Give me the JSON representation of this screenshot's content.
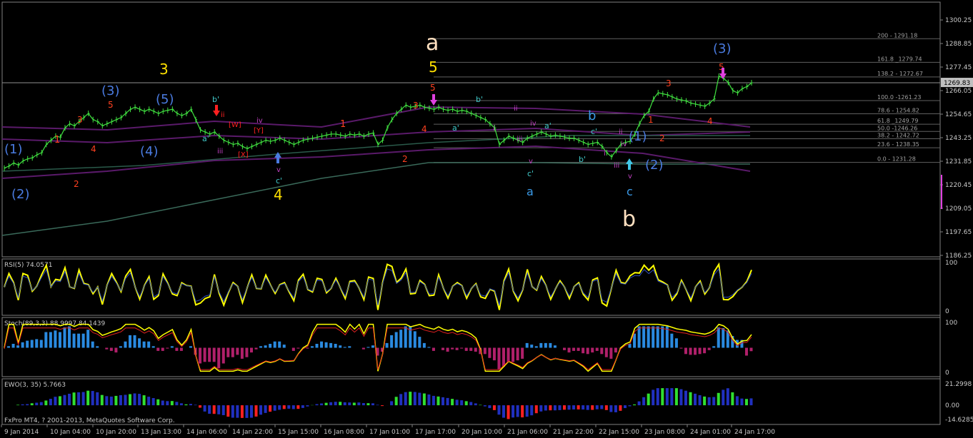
{
  "chart_data": {
    "type": "line",
    "platform_note": "FxPro MT4, ? 2001-2013, MetaQuotes Software Corp.",
    "main": {
      "ylim": [
        1186.25,
        1300.25
      ],
      "price_ticks": [
        "1300.25",
        "1288.85",
        "1277.45",
        "1266.05",
        "1254.65",
        "1243.25",
        "1231.85",
        "1220.45",
        "1209.05",
        "1197.65",
        "1186.25"
      ],
      "current_price": "1269.83",
      "fib_levels": [
        {
          "label": "200 - 1291.18"
        },
        {
          "label": "161.8 _1279.74"
        },
        {
          "label": "138.2 - 1272.67"
        },
        {
          "label": "100.0 -1261.23"
        },
        {
          "label": "78.6 - 1254.82"
        },
        {
          "label": "61.8 _1249.79"
        },
        {
          "label": "50.0 -1246.26"
        },
        {
          "label": "38.2 - 1242.72"
        },
        {
          "label": "23.6 - 1238.35"
        },
        {
          "label": "0.0 - 1231.28"
        }
      ],
      "wave_labels": [
        {
          "text": "(1)",
          "color": "#4a7be0"
        },
        {
          "text": "(2)",
          "color": "#4a7be0"
        },
        {
          "text": "1",
          "color": "#ff4020"
        },
        {
          "text": "2",
          "color": "#ff4020"
        },
        {
          "text": "3",
          "color": "#ff4020"
        },
        {
          "text": "4",
          "color": "#ff4020"
        },
        {
          "text": "5",
          "color": "#ff4020"
        },
        {
          "text": "(3)",
          "color": "#4a7be0"
        },
        {
          "text": "(4)",
          "color": "#4a7be0"
        },
        {
          "text": "(5)",
          "color": "#4a7be0"
        },
        {
          "text": "3",
          "color": "#ffe000"
        },
        {
          "text": "b'",
          "color": "#40c8c8"
        },
        {
          "text": "a'",
          "color": "#40c8c8"
        },
        {
          "text": "ii",
          "color": "#ff2020"
        },
        {
          "text": "[W]",
          "color": "#ff2020"
        },
        {
          "text": "iii",
          "color": "#c040c0"
        },
        {
          "text": "iv",
          "color": "#c040c0"
        },
        {
          "text": "[Y]",
          "color": "#ff2020"
        },
        {
          "text": "[X]",
          "color": "#ff2020"
        },
        {
          "text": "v",
          "color": "#c040c0"
        },
        {
          "text": "c'",
          "color": "#40c8c8"
        },
        {
          "text": "4",
          "color": "#ffe000"
        },
        {
          "text": "1",
          "color": "#ff4020"
        },
        {
          "text": "2",
          "color": "#ff4020"
        },
        {
          "text": "3",
          "color": "#ff4020"
        },
        {
          "text": "4",
          "color": "#ff4020"
        },
        {
          "text": "5",
          "color": "#ff4020"
        },
        {
          "text": "a",
          "color": "#ffe0c0"
        },
        {
          "text": "5",
          "color": "#ffe000"
        },
        {
          "text": "b'",
          "color": "#40c8c8"
        },
        {
          "text": "a'",
          "color": "#40c8c8"
        },
        {
          "text": "i",
          "color": "#c040c0"
        },
        {
          "text": "ii",
          "color": "#c040c0"
        },
        {
          "text": "iii",
          "color": "#c040c0"
        },
        {
          "text": "iv",
          "color": "#c040c0"
        },
        {
          "text": "a'",
          "color": "#40c8c8"
        },
        {
          "text": "v",
          "color": "#c040c0"
        },
        {
          "text": "c'",
          "color": "#40c8c8"
        },
        {
          "text": "a",
          "color": "#3a9ae8"
        },
        {
          "text": "b",
          "color": "#3a9ae8"
        },
        {
          "text": "c'",
          "color": "#40c8c8"
        },
        {
          "text": "b'",
          "color": "#40c8c8"
        },
        {
          "text": "i",
          "color": "#c040c0"
        },
        {
          "text": "ii",
          "color": "#c040c0"
        },
        {
          "text": "iii",
          "color": "#c040c0"
        },
        {
          "text": "iv",
          "color": "#c040c0"
        },
        {
          "text": "v",
          "color": "#c040c0"
        },
        {
          "text": "c",
          "color": "#3a9ae8"
        },
        {
          "text": "b",
          "color": "#ffe0c0"
        },
        {
          "text": "(1)",
          "color": "#4a7be0"
        },
        {
          "text": "(2)",
          "color": "#4a7be0"
        },
        {
          "text": "1",
          "color": "#ff4020"
        },
        {
          "text": "2",
          "color": "#ff4020"
        },
        {
          "text": "3",
          "color": "#ff4020"
        },
        {
          "text": "4",
          "color": "#ff4020"
        },
        {
          "text": "5",
          "color": "#ff4020"
        },
        {
          "text": "(3)",
          "color": "#4a7be0"
        }
      ],
      "series": [
        {
          "values": [
            1228.5,
            1229.5,
            1231,
            1230,
            1232,
            1233,
            1233.5,
            1235,
            1236,
            1240,
            1242,
            1244,
            1243.5,
            1248,
            1250,
            1249,
            1251,
            1253,
            1255,
            1252,
            1251,
            1249,
            1250,
            1251,
            1252,
            1253,
            1255,
            1257,
            1258,
            1257,
            1256,
            1257,
            1256,
            1255,
            1256,
            1256.5,
            1257,
            1255,
            1254,
            1255,
            1257,
            1252,
            1247,
            1246,
            1245,
            1246,
            1244,
            1242,
            1241,
            1240,
            1240.5,
            1239,
            1238,
            1239,
            1240,
            1241,
            1242,
            1241.5,
            1242,
            1243,
            1242,
            1241,
            1240,
            1241,
            1242,
            1242.5,
            1243,
            1243.5,
            1244,
            1244.5,
            1245,
            1245,
            1244.5,
            1244,
            1245,
            1244.5,
            1245,
            1244,
            1245,
            1245.5,
            1240,
            1242,
            1248,
            1252,
            1255,
            1257,
            1259,
            1258,
            1258.5,
            1259,
            1258,
            1257.5,
            1257,
            1258,
            1257,
            1256.5,
            1257,
            1256,
            1256.5,
            1256,
            1255,
            1254,
            1253,
            1252,
            1250,
            1248,
            1240,
            1242,
            1244,
            1243,
            1242,
            1241,
            1243,
            1244,
            1245,
            1246,
            1245,
            1244,
            1244.5,
            1244,
            1243.5,
            1243,
            1243,
            1242,
            1241,
            1240,
            1240.5,
            1241,
            1239,
            1236,
            1234,
            1237,
            1240,
            1241,
            1241.5,
            1245,
            1250,
            1254,
            1256,
            1262,
            1265,
            1264.5,
            1264,
            1263,
            1262,
            1261.5,
            1261,
            1260,
            1259.5,
            1259,
            1258.5,
            1260,
            1262,
            1273,
            1272,
            1270,
            1266,
            1265,
            1267,
            1268,
            1269.83
          ]
        }
      ]
    },
    "rsi": {
      "label": "RSI(5) 74.0571",
      "ticks": [
        "100",
        "0"
      ]
    },
    "stoch": {
      "label": "Stoch(89,3,3) 88.9997 84.1439",
      "ticks": [
        "100",
        "0"
      ]
    },
    "ewo": {
      "label": "EWO(3, 35) 5.7663",
      "ticks": [
        "21.2998",
        "0.00",
        "-14.6285"
      ]
    },
    "x_ticks": [
      "9 Jan 2014",
      "10 Jan 04:00",
      "10 Jan 20:00",
      "13 Jan 13:00",
      "14 Jan 06:00",
      "14 Jan 22:00",
      "15 Jan 15:00",
      "16 Jan 08:00",
      "17 Jan 01:00",
      "17 Jan 17:00",
      "20 Jan 10:00",
      "21 Jan 06:00",
      "21 Jan 22:00",
      "22 Jan 15:00",
      "23 Jan 08:00",
      "24 Jan 01:00",
      "24 Jan 17:00"
    ],
    "colors": {
      "background": "#000000",
      "price": "#40e040",
      "axis": "#c8c8c8",
      "rsi": "#ffff00"
    }
  }
}
